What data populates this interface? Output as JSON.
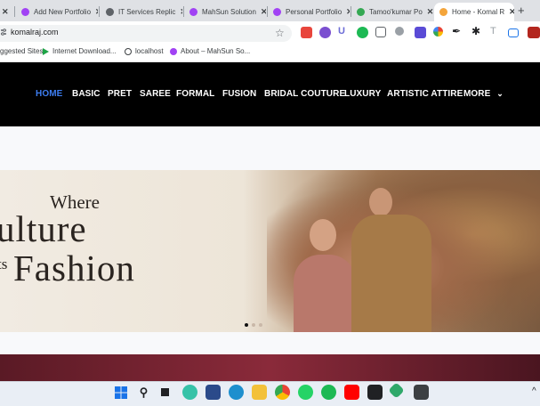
{
  "browser": {
    "tabs": [
      {
        "title": "Add New Portfolio",
        "color": "#a142f4"
      },
      {
        "title": "IT Services Replic",
        "color": "#5f6368"
      },
      {
        "title": "MahSun Solution",
        "color": "#a142f4"
      },
      {
        "title": "Personal Portfolio",
        "color": "#a142f4"
      },
      {
        "title": "Tamoo'kumar Po",
        "color": "#34a853"
      },
      {
        "title": "Home - Komal R",
        "color": "#f4a53b"
      }
    ],
    "tab_close": "✕",
    "new_tab": "+",
    "url": "komalraj.com",
    "bookmarks": [
      "ggested Sites",
      "Internet Download...",
      "localhost",
      "About – MahSun So..."
    ]
  },
  "site": {
    "nav": [
      "HOME",
      "BASIC",
      "PRET",
      "SAREE",
      "FORMAL",
      "FUSION",
      "BRIDAL COUTURE",
      "LUXURY",
      "ARTISTIC ATTIRE",
      "MORE"
    ],
    "more_caret": "⌄",
    "hero": {
      "line1": "Where",
      "line2": "ulture",
      "line3_prefix": "ts",
      "line3": "Fashion"
    }
  },
  "colors": {
    "nav_active": "#3d7df0",
    "nav_bg": "#000000"
  }
}
